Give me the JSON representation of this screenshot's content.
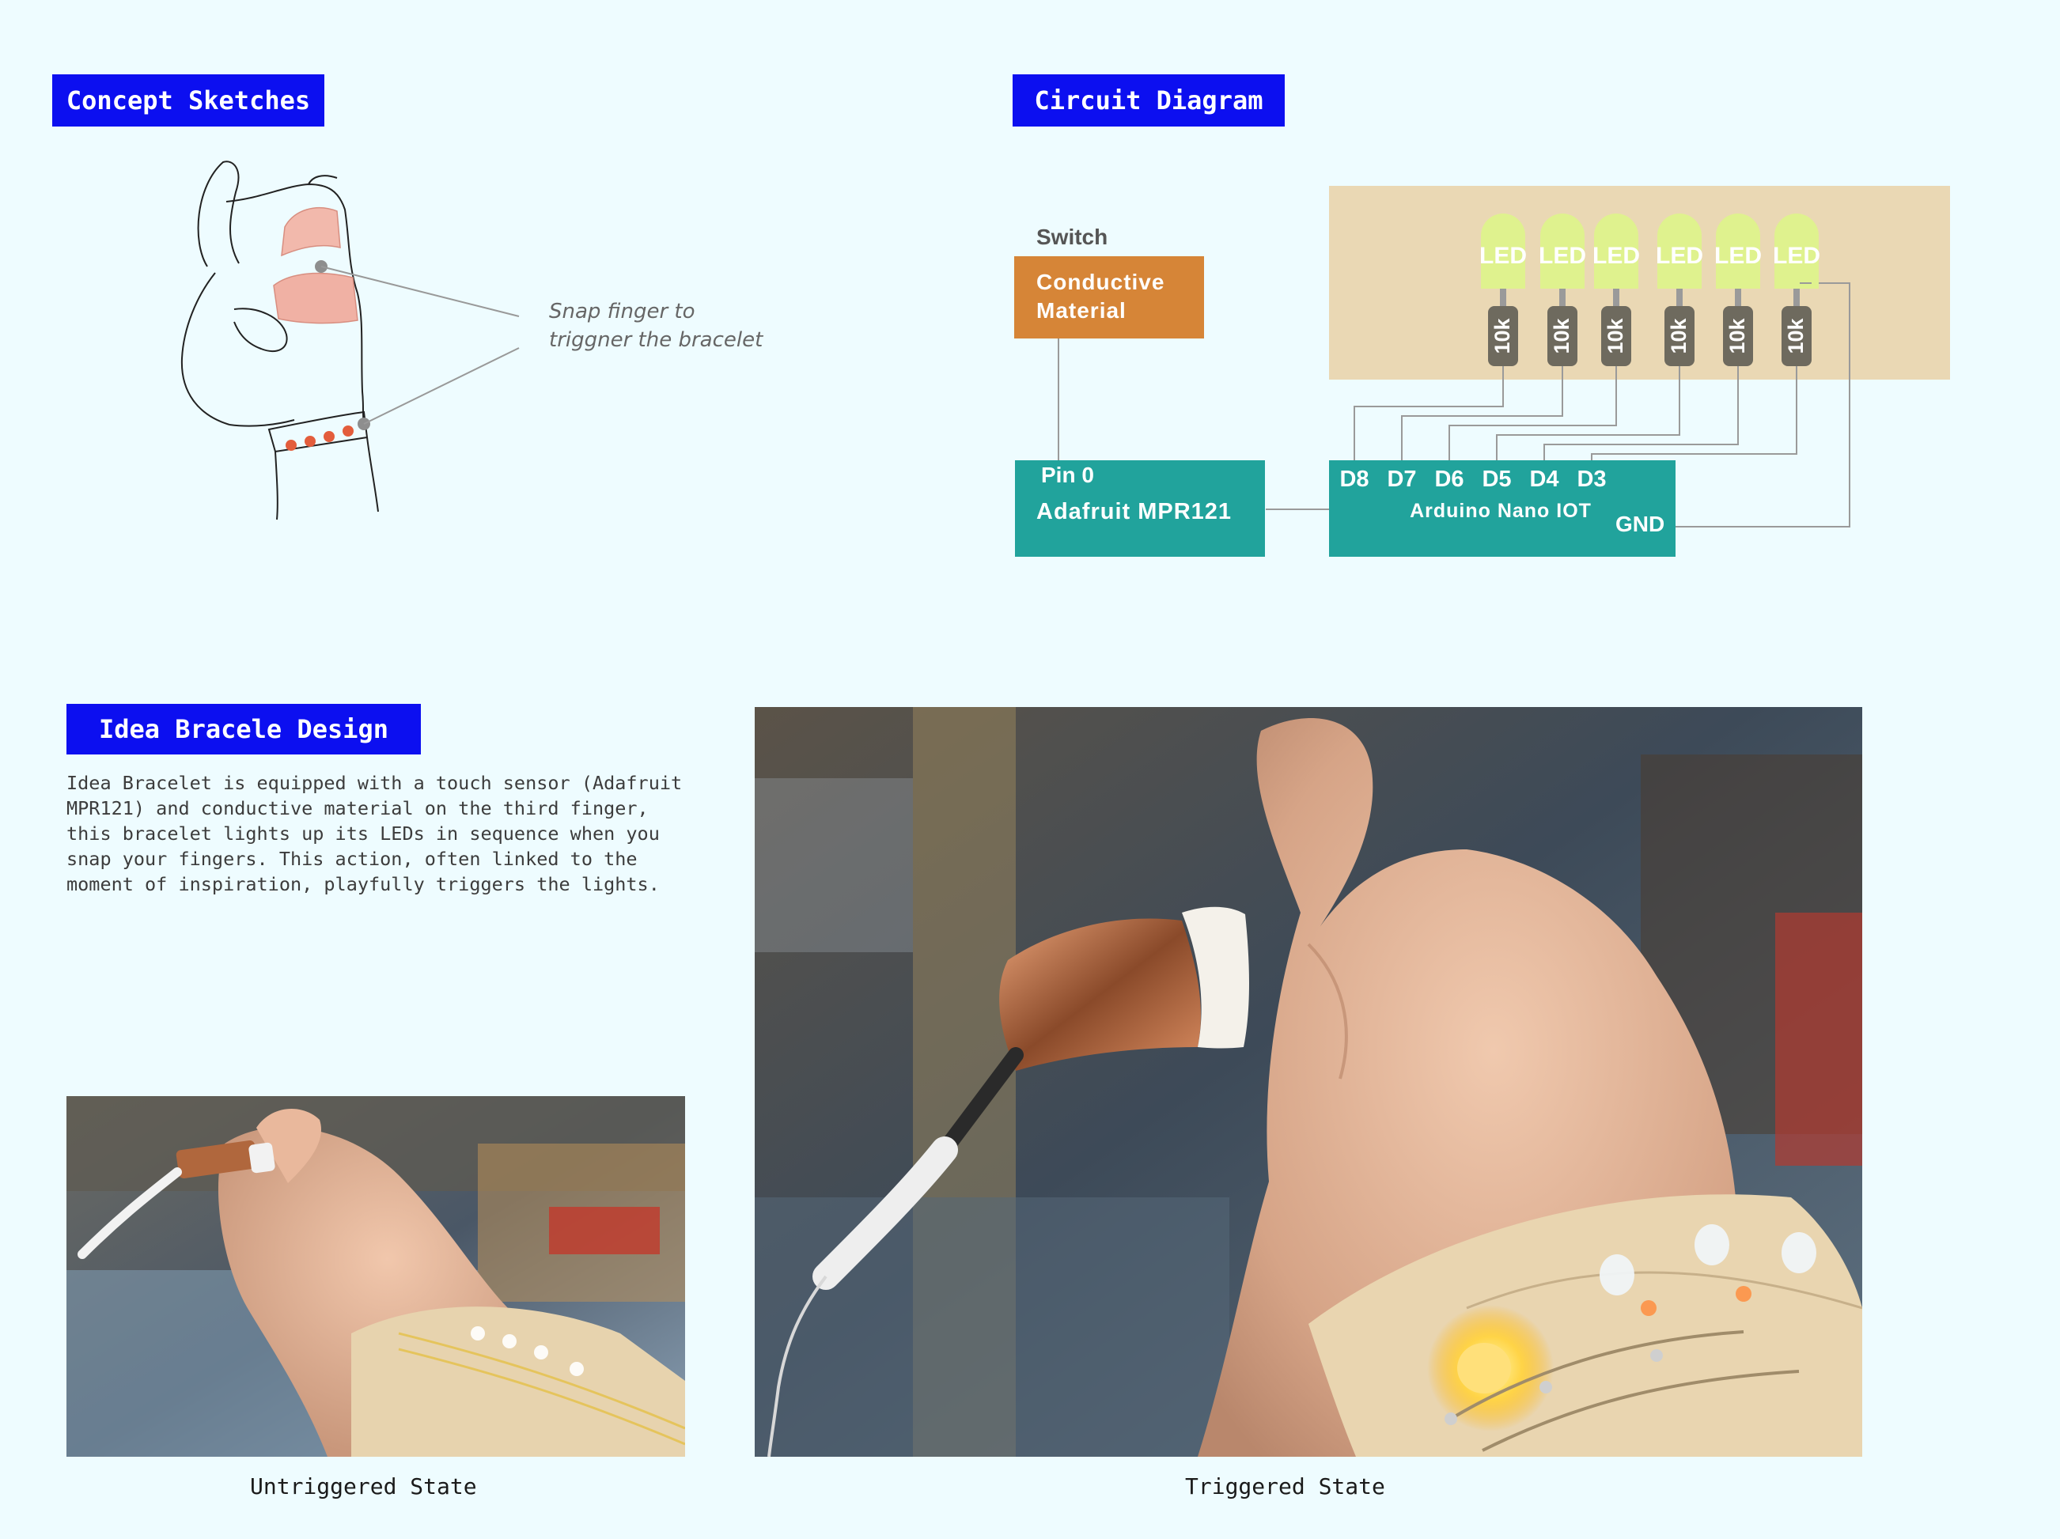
{
  "sections": {
    "concept_title": "Concept Sketches",
    "circuit_title": "Circuit Diagram",
    "design_title": "Idea Bracele Design"
  },
  "sketch": {
    "annotation_line1": "Snap finger to",
    "annotation_line2": "triggner the bracelet"
  },
  "circuit": {
    "switch_label": "Switch",
    "conductive_line1": "Conductive",
    "conductive_line2": "Material",
    "mpr_pin": "Pin 0",
    "mpr_name": "Adafruit MPR121",
    "nano_pins": [
      "D8",
      "D7",
      "D6",
      "D5",
      "D4",
      "D3"
    ],
    "nano_name": "Arduino Nano IOT",
    "gnd_label": "GND",
    "led_label": "LED",
    "resistor_label": "10k",
    "colors": {
      "led": "#dff28e",
      "led_panel": "#ead8b4",
      "resistor": "#6e6a5e",
      "conductive": "#d68537",
      "board": "#21a39c"
    }
  },
  "design": {
    "description": "Idea Bracelet is equipped with a touch sensor (Adafruit MPR121) and conductive material on the third finger, this bracelet lights up its LEDs in sequence when you snap your fingers. This action, often linked to the moment of inspiration, playfully triggers the lights."
  },
  "photos": {
    "untriggered_caption": "Untriggered State",
    "triggered_caption": "Triggered State"
  }
}
